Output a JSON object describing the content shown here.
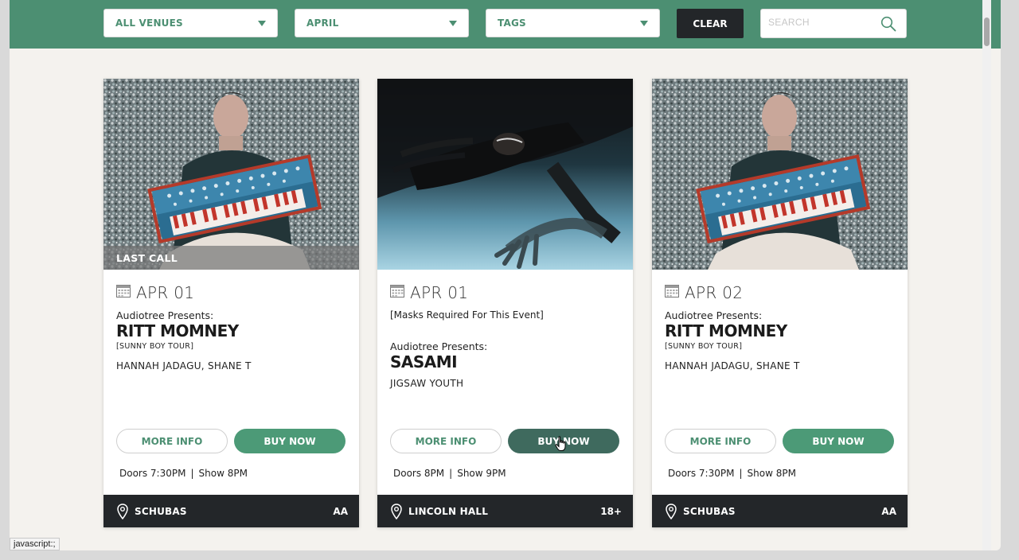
{
  "filters": {
    "venues": "ALL VENUES",
    "month": "APRIL",
    "tags": "TAGS",
    "clear": "CLEAR",
    "search_placeholder": "SEARCH"
  },
  "events": [
    {
      "badge": "LAST CALL",
      "date": "APR 01",
      "presenter": "Audiotree Presents:",
      "headliner": "RITT MOMNEY",
      "tour": "[SUNNY BOY TOUR]",
      "support": "HANNAH JADAGU, SHANE T",
      "more_info": "MORE INFO",
      "buy": "BUY NOW",
      "doors": "Doors 7:30PM",
      "sep": "|",
      "show": "Show 8PM",
      "venue": "SCHUBAS",
      "age": "AA"
    },
    {
      "note": "[Masks Required For This Event]",
      "date": "APR 01",
      "presenter": "Audiotree Presents:",
      "headliner": "SASAMI",
      "support": "JIGSAW YOUTH",
      "more_info": "MORE INFO",
      "buy": "BUY NOW",
      "doors": "Doors 8PM",
      "sep": "|",
      "show": "Show 9PM",
      "venue": "LINCOLN HALL",
      "age": "18+"
    },
    {
      "date": "APR 02",
      "presenter": "Audiotree Presents:",
      "headliner": "RITT MOMNEY",
      "tour": "[SUNNY BOY TOUR]",
      "support": "HANNAH JADAGU, SHANE T",
      "more_info": "MORE INFO",
      "buy": "BUY NOW",
      "doors": "Doors 7:30PM",
      "sep": "|",
      "show": "Show 8PM",
      "venue": "SCHUBAS",
      "age": "AA"
    }
  ],
  "status_bar": "javascript:;",
  "colors": {
    "brand_green": "#4c8f72",
    "button_green": "#4c9a77",
    "button_hover": "#3f6a5e",
    "dark": "#232629"
  }
}
